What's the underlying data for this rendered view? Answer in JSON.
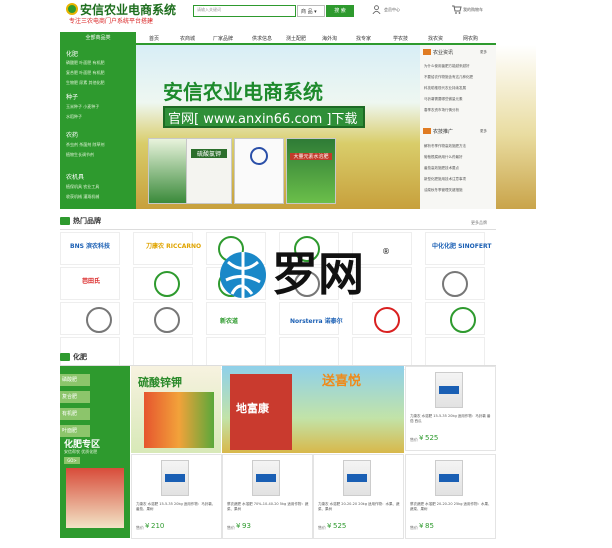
{
  "header": {
    "title": "安信农业电商系统",
    "subtitle": "专注三农电商门户系统平台搭建",
    "search": {
      "placeholder": "请输入关键词",
      "select": "商 品 ▾",
      "button": "搜 索"
    },
    "user_link": "会员中心",
    "cart_link": "我的购物车"
  },
  "nav": {
    "category_header": "全部商品类",
    "items": [
      "首页",
      "农商城",
      "厂家品牌",
      "供求信息",
      "测土配肥",
      "海外淘",
      "找专家",
      "学农技",
      "找农资",
      "网农购"
    ]
  },
  "sidebar": {
    "groups": [
      {
        "title": "化肥",
        "rows": [
          "磷酸肥 叶面肥 有机肥",
          "复合肥 叶面肥 有机肥",
          "生物肥 尿素 其他化肥"
        ]
      },
      {
        "title": "种子",
        "rows": [
          "玉米种子 小麦种子",
          "水稻种子"
        ]
      },
      {
        "title": "农药",
        "rows": [
          "杀虫剂 杀菌剂 除草剂",
          "植物生长调节剂"
        ]
      },
      {
        "title": "农机具",
        "rows": [
          "植保机具 农业工具",
          "收获机械 灌溉机械"
        ]
      }
    ]
  },
  "banner": {
    "title": "安信农业电商系统",
    "url": "官网[ www.anxin66.com ]下载",
    "bag_labels": [
      "硫酸氯钾",
      "",
      "",
      "大量元素水溶肥"
    ]
  },
  "right_panel": {
    "news_title": "农业资讯",
    "news_more": "更多",
    "news_items": [
      "为什么使用菌肥方能越来越好",
      "不要给农作物施含有这几种化肥",
      "科技助推现代农业持续发展",
      "马铃薯需要哪些微量元素",
      "春季农资市场行情分析"
    ],
    "promo_title": "农技推广",
    "promo_more": "更多",
    "promo_items": [
      "解析冬季作物高效施肥方法",
      "葡萄根腐病用什么药最好",
      "番茄高效施肥技术要点",
      "新型化肥施用技术注意事项",
      "油菜秋冬季管理关键措施"
    ]
  },
  "brands": {
    "title": "热门品牌",
    "more": "更多品牌",
    "names": [
      "BNS 滨农科技",
      "刀康农 RICCARNO",
      "",
      "",
      "中化化肥 SINOFERT",
      "芭田氏",
      "",
      "",
      "",
      "",
      "",
      "",
      "新农道",
      "Norsterra 诺泰尔",
      "",
      ""
    ],
    "watermark": "罗网",
    "registered": "®"
  },
  "fertilizer": {
    "title": "化肥",
    "tabs": [
      "磷酸肥",
      "复合肥",
      "有机肥",
      "叶面肥"
    ],
    "zone_title": "化肥专区",
    "zone_sub": "安信帮农 优质化肥",
    "zone_btn": "GO>",
    "ad1": "硫酸锌钾",
    "ad2_title": "送喜悦",
    "ad2_bag": "地富康",
    "price_label": "售价",
    "products": [
      {
        "title": "力康农 水溶肥 15-5-35 20kg 适用作物：马铃薯 番茄 西瓜",
        "price": "525"
      },
      {
        "title": "力康农 水溶肥 15-5-35 20kg 适用作物：马铃薯、番茄、果树",
        "price": "210"
      },
      {
        "title": "蔡农蔬肥 水溶肥 70%-10-40-20 5kg 适用作物：蔬菜、果树",
        "price": "93"
      },
      {
        "title": "力康农 水溶肥 20-20-20 20kg 适用作物：水果、蔬菜、果树",
        "price": "525"
      },
      {
        "title": "蔡农蔬肥 水溶肥 20-20-20 25kg 适用作物：水果、蔬菜、果树",
        "price": "85"
      }
    ]
  },
  "colors": {
    "accent": "#2e9a2e",
    "red": "#d92020"
  }
}
